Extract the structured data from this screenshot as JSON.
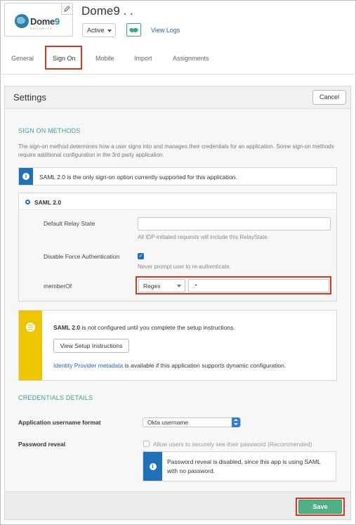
{
  "app": {
    "logo_text_main": "Dome",
    "logo_text_num": "9",
    "logo_tagline": "SECURITY",
    "title": "Dome9 . .",
    "status": "Active",
    "view_logs": "View Logs"
  },
  "tabs": [
    {
      "label": "General"
    },
    {
      "label": "Sign On",
      "active": true
    },
    {
      "label": "Mobile"
    },
    {
      "label": "Import"
    },
    {
      "label": "Assignments"
    }
  ],
  "settings": {
    "title": "Settings",
    "cancel_label": "Cancel",
    "sign_on_methods_heading": "SIGN ON METHODS",
    "description": "The sign-on method determines how a user signs into and manages their credentials for an application. Some sign-on methods require additional configuration in the 3rd party application.",
    "info_message": "SAML 2.0 is the only sign-on option currently supported for this application.",
    "saml_option": "SAML 2.0",
    "default_relay_state_label": "Default Relay State",
    "default_relay_state_value": "",
    "default_relay_state_hint": "All IDP-initiated requests will include this RelayState",
    "disable_force_auth_label": "Disable Force Authentication",
    "disable_force_auth_checked": true,
    "disable_force_auth_hint": "Never prompt user to re-authenticate.",
    "memberof_label": "memberOf",
    "memberof_match": "Regex",
    "memberof_value": ".*",
    "notice_bold": "SAML 2.0",
    "notice_text": " is not configured until you complete the setup instructions.",
    "setup_button": "View Setup Instructions",
    "metadata_link": "Identity Provider metadata",
    "metadata_text": " is available if this application supports dynamic configuration.",
    "credentials_heading": "CREDENTIALS DETAILS",
    "username_format_label": "Application username format",
    "username_format_value": "Okta username",
    "password_reveal_label": "Password reveal",
    "password_reveal_option": "Allow users to securely see their password (Recommended)",
    "password_reveal_checked": false,
    "password_info": "Password reveal is disabled, since this app is using SAML with no password.",
    "save_label": "Save"
  },
  "colors": {
    "accent_green": "#3aa388",
    "highlight_red": "#d9371f",
    "info_blue": "#1f72b8",
    "notice_yellow": "#edc600",
    "save_green": "#4fb085"
  }
}
